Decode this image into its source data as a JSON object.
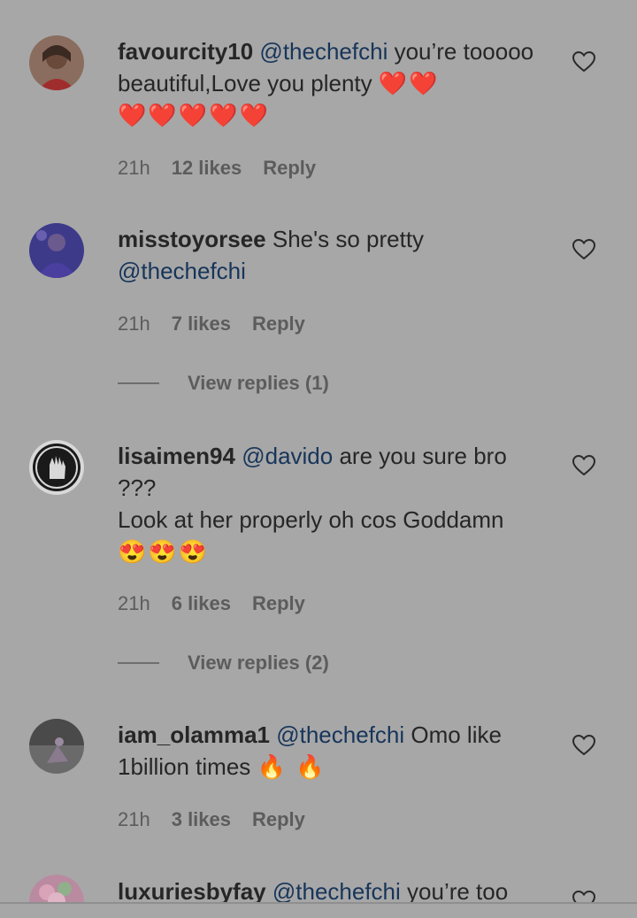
{
  "comments": [
    {
      "username": "favourcity10",
      "mention": "@thechefchi",
      "body_a": " you’re tooooo beautiful,Love you plenty ",
      "emojis_a": "❤️❤️",
      "emojis_b": "❤️❤️❤️❤️❤️",
      "time": "21h",
      "likes": "12 likes",
      "reply": "Reply"
    },
    {
      "username": "misstoyorsee",
      "body_a": " She's so pretty ",
      "mention": "@thechefchi",
      "time": "21h",
      "likes": "7 likes",
      "reply": "Reply",
      "view_replies": "View replies (1)"
    },
    {
      "username": "lisaimen94",
      "mention": "@davido",
      "body_a": " are you sure bro ???",
      "body_b": "Look at her properly oh cos Goddamn",
      "emojis_b": "😍😍😍",
      "time": "21h",
      "likes": "6 likes",
      "reply": "Reply",
      "view_replies": "View replies (2)"
    },
    {
      "username": "iam_olamma1",
      "mention": "@thechefchi",
      "body_a": " Omo like 1billion times ",
      "emojis_a": "🔥 🔥",
      "time": "21h",
      "likes": "3 likes",
      "reply": "Reply"
    },
    {
      "username": "luxuriesbyfay",
      "mention": "@thechefchi",
      "body_a": " you’re too"
    }
  ],
  "icons": {
    "like": "heart-outline-icon"
  },
  "colors": {
    "background": "#a7a7a7",
    "mention": "#17355a",
    "meta": "#5c5c5c"
  }
}
